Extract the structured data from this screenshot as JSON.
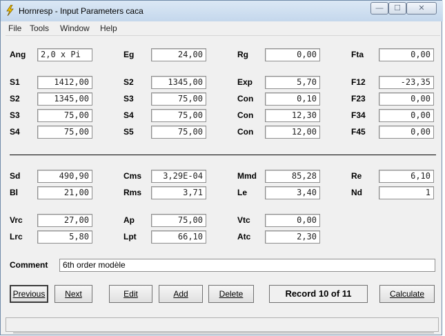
{
  "window": {
    "title": "Hornresp - Input Parameters   caca",
    "minimize_glyph": "—",
    "maximize_glyph": "☐",
    "close_glyph": "✕"
  },
  "menu": [
    "File",
    "Tools",
    "Window",
    "Help"
  ],
  "params": {
    "Ang": {
      "label": "Ang",
      "value": "2,0 x Pi"
    },
    "Eg": {
      "label": "Eg",
      "value": "24,00"
    },
    "Rg": {
      "label": "Rg",
      "value": "0,00"
    },
    "Fta": {
      "label": "Fta",
      "value": "0,00"
    },
    "S1": {
      "label": "S1",
      "value": "1412,00"
    },
    "S2_col2": {
      "label": "S2",
      "value": "1345,00"
    },
    "Exp": {
      "label": "Exp",
      "value": "5,70"
    },
    "F12": {
      "label": "F12",
      "value": "-23,35"
    },
    "S2": {
      "label": "S2",
      "value": "1345,00"
    },
    "S3_col2": {
      "label": "S3",
      "value": "75,00"
    },
    "Con1": {
      "label": "Con",
      "value": "0,10"
    },
    "F23": {
      "label": "F23",
      "value": "0,00"
    },
    "S3": {
      "label": "S3",
      "value": "75,00"
    },
    "S4_col2": {
      "label": "S4",
      "value": "75,00"
    },
    "Con2": {
      "label": "Con",
      "value": "12,30"
    },
    "F34": {
      "label": "F34",
      "value": "0,00"
    },
    "S4": {
      "label": "S4",
      "value": "75,00"
    },
    "S5": {
      "label": "S5",
      "value": "75,00"
    },
    "Con3": {
      "label": "Con",
      "value": "12,00"
    },
    "F45": {
      "label": "F45",
      "value": "0,00"
    },
    "Sd": {
      "label": "Sd",
      "value": "490,90"
    },
    "Cms": {
      "label": "Cms",
      "value": "3,29E-04"
    },
    "Mmd": {
      "label": "Mmd",
      "value": "85,28"
    },
    "Re": {
      "label": "Re",
      "value": "6,10"
    },
    "Bl": {
      "label": "Bl",
      "value": "21,00"
    },
    "Rms": {
      "label": "Rms",
      "value": "3,71"
    },
    "Le": {
      "label": "Le",
      "value": "3,40"
    },
    "Nd": {
      "label": "Nd",
      "value": "1"
    },
    "Vrc": {
      "label": "Vrc",
      "value": "27,00"
    },
    "Ap": {
      "label": "Ap",
      "value": "75,00"
    },
    "Vtc": {
      "label": "Vtc",
      "value": "0,00"
    },
    "Lrc": {
      "label": "Lrc",
      "value": "5,80"
    },
    "Lpt": {
      "label": "Lpt",
      "value": "66,10"
    },
    "Atc": {
      "label": "Atc",
      "value": "2,30"
    }
  },
  "comment": {
    "label": "Comment",
    "value": "6th order modèle"
  },
  "buttons": {
    "previous": "Previous",
    "next": "Next",
    "edit": "Edit",
    "add": "Add",
    "delete": "Delete",
    "calculate": "Calculate"
  },
  "record": "Record 10 of 11",
  "accent_colors": {
    "titlebar": "#c4d7ec",
    "background": "#f0f0f0"
  }
}
